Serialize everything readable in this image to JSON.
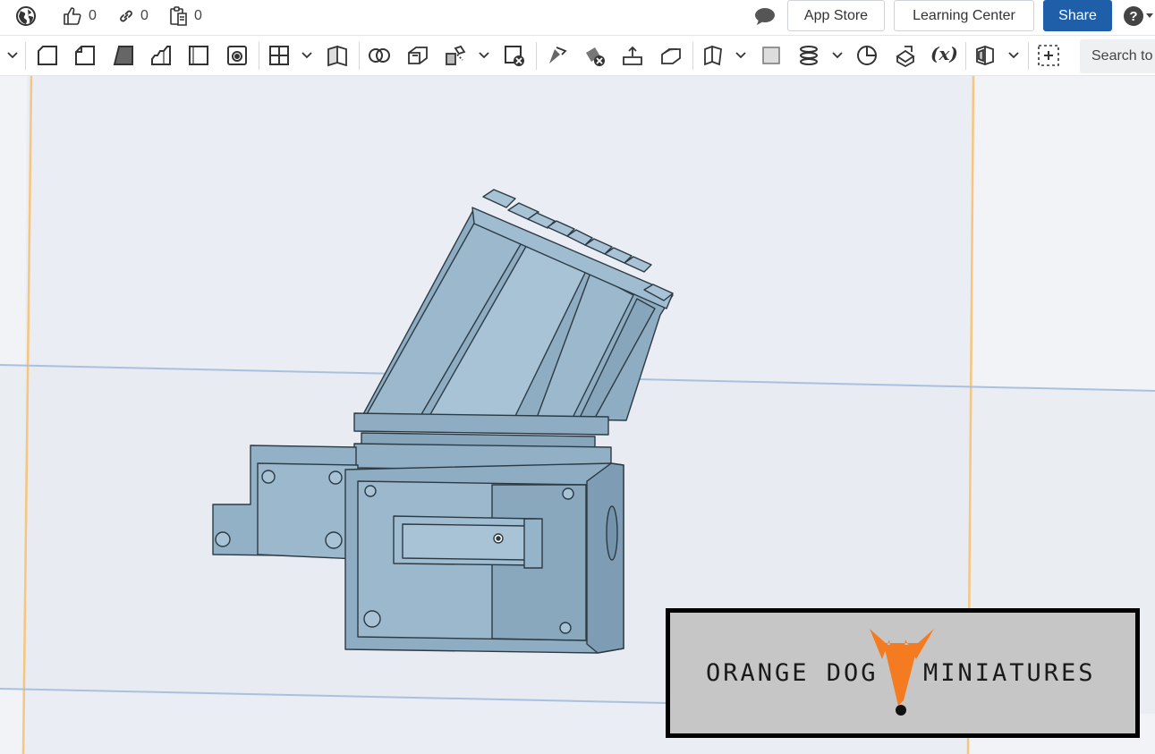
{
  "topbar": {
    "icons": [
      "globe-icon",
      "thumbs-up-icon",
      "link-icon",
      "clipboard-icon",
      "comment-icon",
      "help-icon"
    ],
    "likes_count": "0",
    "links_count": "0",
    "copies_count": "0",
    "app_store_label": "App Store",
    "learning_center_label": "Learning Center",
    "share_label": "Share"
  },
  "toolbar": {
    "tool_icons": [
      "sketch-icon",
      "extrude-icon",
      "revolve-icon",
      "sweep-icon",
      "loft-icon",
      "thicken-icon",
      "fillet-icon",
      "chamfer-icon",
      "draft-icon",
      "shell-icon",
      "hole-icon",
      "pattern-icon",
      "mirror-icon",
      "boolean-icon",
      "split-icon",
      "transform-icon",
      "delete-part-icon",
      "modify-fillet-icon",
      "delete-face-icon",
      "move-face-icon",
      "replace-face-icon",
      "plane-icon",
      "helix-icon",
      "mate-connector-icon",
      "measure-icon",
      "variable-icon",
      "section-view-icon",
      "add-custom-feature-icon"
    ],
    "variable_label": "(x)",
    "search_placeholder": "Search to"
  },
  "viewport": {
    "colors": {
      "part_fill": "#8fadc2",
      "part_face_light": "#a8c3d6",
      "part_edge": "#2c3a44",
      "plane_line": "#a9c1de",
      "plane_edge_orange": "#f6c57e"
    }
  },
  "logo": {
    "left_text": "ORANGE DOG",
    "right_text": "MINIATURES",
    "accent_color": "#f47b20"
  }
}
